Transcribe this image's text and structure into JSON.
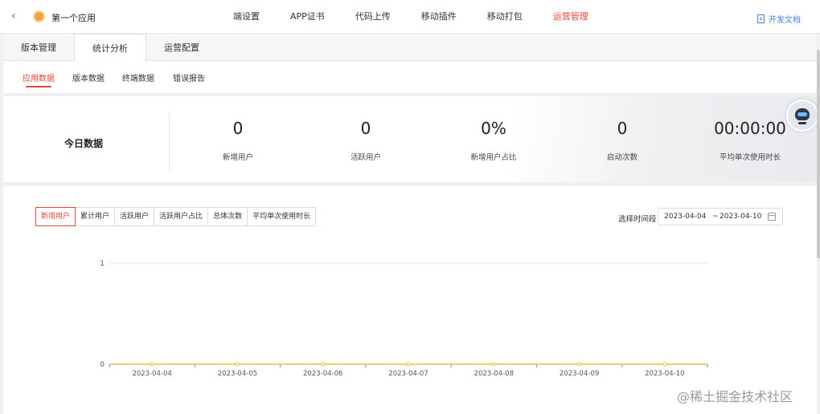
{
  "header": {
    "app_name": "第一个应用",
    "nav": [
      "端设置",
      "APP证书",
      "代码上传",
      "移动插件",
      "移动打包",
      "运营管理"
    ],
    "active_nav": "运营管理",
    "doc_link": "开发文档"
  },
  "tabs": [
    "版本管理",
    "统计分析",
    "运营配置"
  ],
  "subtabs": [
    "应用数据",
    "版本数据",
    "终端数据",
    "错误报告"
  ],
  "stats": {
    "title": "今日数据",
    "items": [
      {
        "value": "0",
        "label": "新增用户"
      },
      {
        "value": "0",
        "label": "活跃用户"
      },
      {
        "value": "0%",
        "label": "新增用户占比"
      },
      {
        "value": "0",
        "label": "启动次数"
      },
      {
        "value": "00:00:00",
        "label": "平均单次使用时长"
      }
    ]
  },
  "metric_buttons": [
    "新增用户",
    "累计用户",
    "活跃用户",
    "活跃用户占比",
    "总体次数",
    "平均单次使用时长"
  ],
  "date_range": {
    "label": "选择时间段",
    "start": "2023-04-04",
    "separator": "~",
    "end": "2023-04-10"
  },
  "chart_data": {
    "type": "line",
    "categories": [
      "2023-04-04",
      "2023-04-05",
      "2023-04-06",
      "2023-04-07",
      "2023-04-08",
      "2023-04-09",
      "2023-04-10"
    ],
    "series": [
      {
        "values": [
          0,
          0,
          0,
          0,
          0,
          0,
          0
        ],
        "color": "#f5b73b"
      }
    ],
    "yticks": [
      "1",
      "0"
    ],
    "ylim": [
      0,
      1
    ],
    "grid": true
  },
  "watermark": "@稀土掘金技术社区"
}
